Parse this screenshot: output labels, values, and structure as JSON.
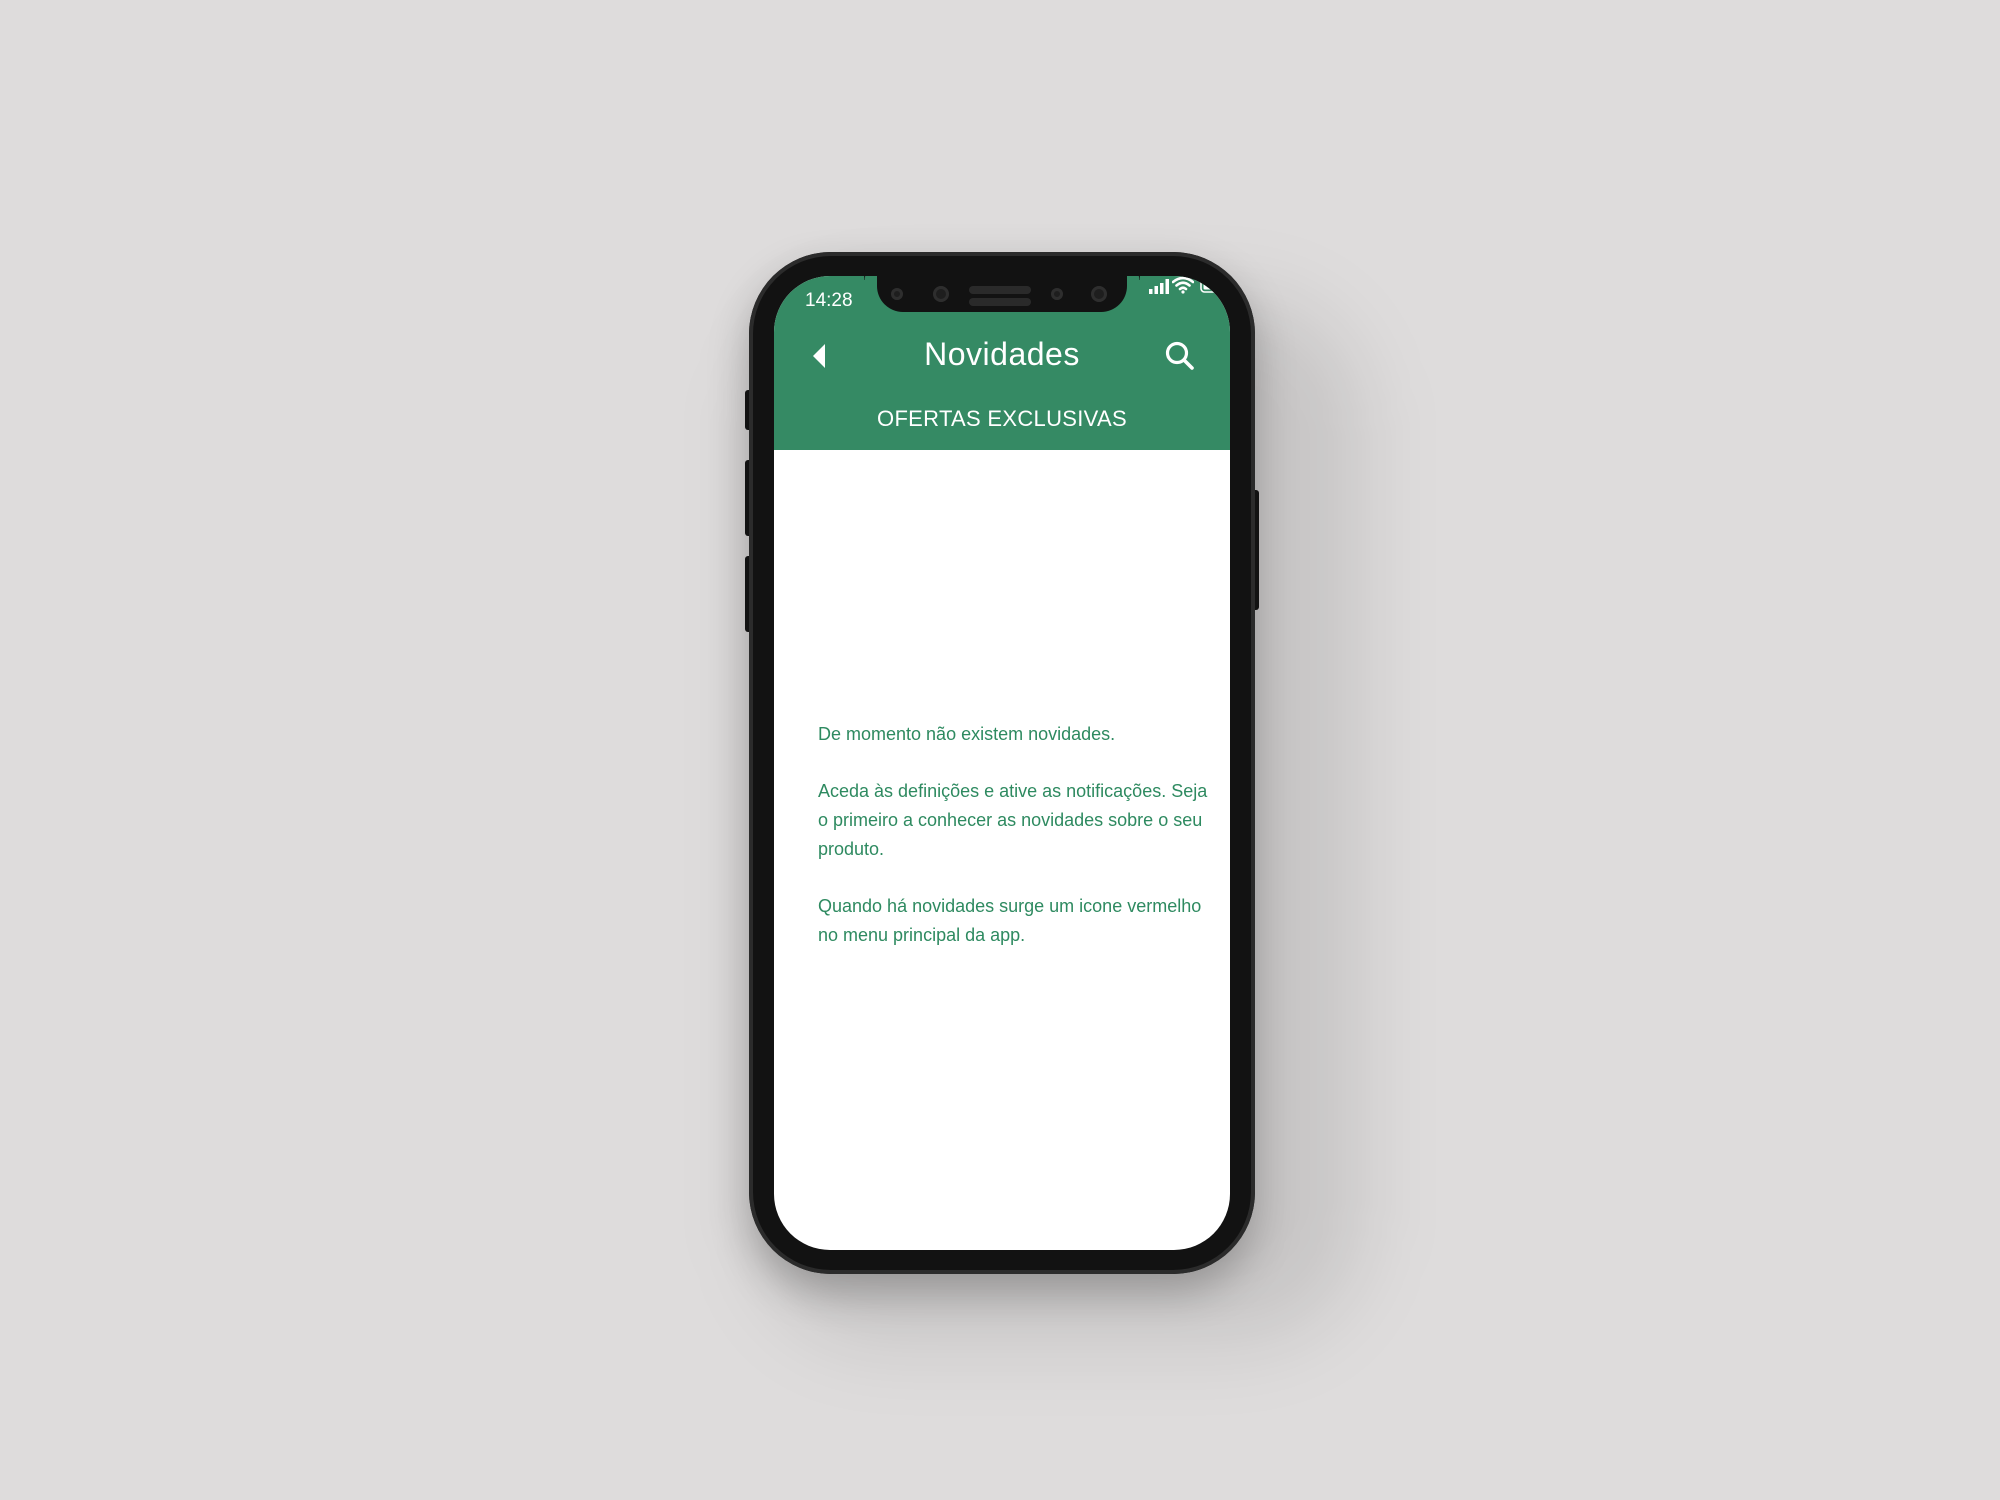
{
  "status_bar": {
    "time": "14:28",
    "icons": [
      "signal-icon",
      "wifi-icon",
      "battery-icon"
    ]
  },
  "header": {
    "title": "Novidades",
    "back_icon": "back-arrow-icon",
    "search_icon": "search-icon",
    "tab_label": "OFERTAS EXCLUSIVAS"
  },
  "empty_state": {
    "line1": "De momento não existem novidades.",
    "line2": "Aceda às definições e ative as notificações. Seja o primeiro a conhecer as novidades sobre o seu produto.",
    "line3": "Quando há novidades surge um icone vermelho no menu principal da app."
  },
  "colors": {
    "brand_green": "#358a64",
    "text_green": "#2e8a60",
    "background": "#dedcdc"
  }
}
